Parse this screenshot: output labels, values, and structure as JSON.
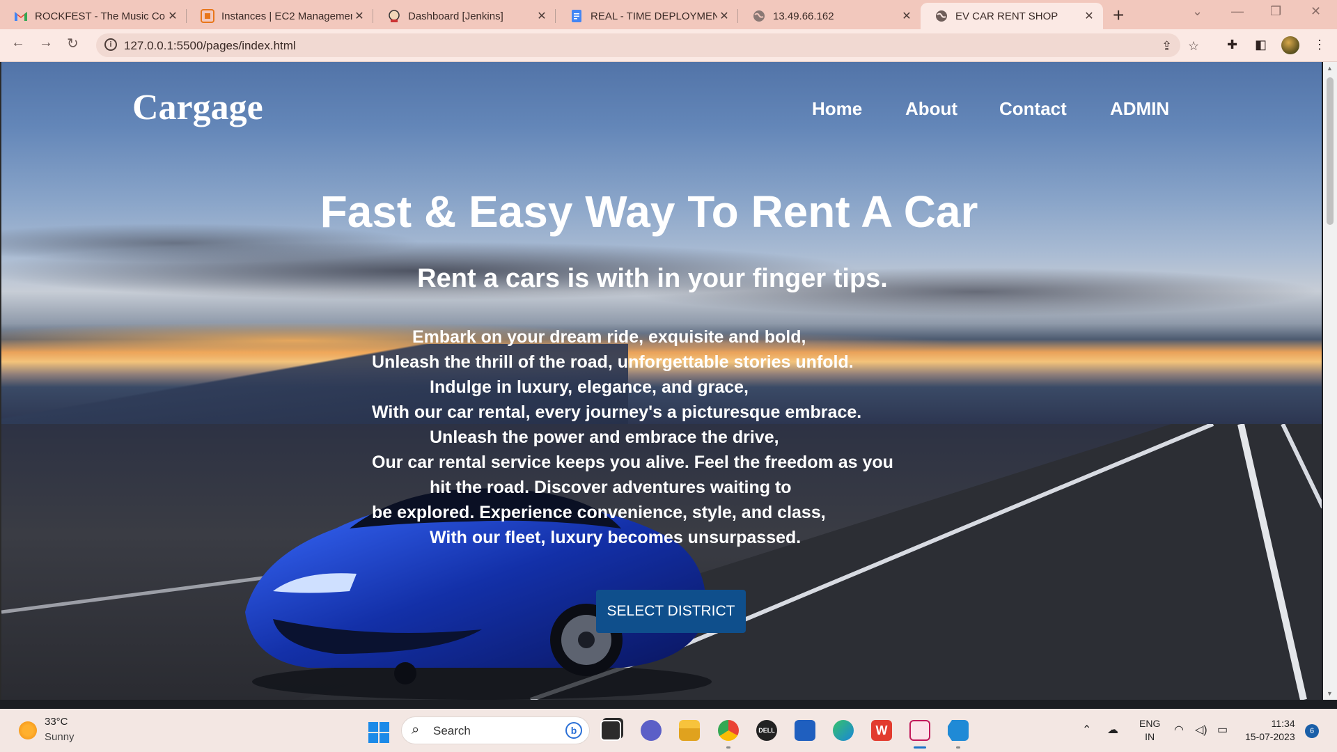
{
  "browser": {
    "tabs": [
      {
        "title": "ROCKFEST - The Music Con",
        "favicon": "gmail-icon"
      },
      {
        "title": "Instances | EC2 Managemen",
        "favicon": "aws-icon"
      },
      {
        "title": "Dashboard [Jenkins]",
        "favicon": "jenkins-icon"
      },
      {
        "title": "REAL - TIME DEPLOYMENT",
        "favicon": "docs-icon"
      },
      {
        "title": "13.49.66.162",
        "favicon": "globe-icon"
      },
      {
        "title": "EV CAR RENT SHOP",
        "favicon": "globe-icon"
      }
    ],
    "active_tab": 5,
    "url": "127.0.0.1:5500/pages/index.html"
  },
  "site": {
    "brand": "Cargage",
    "nav": [
      {
        "label": "Home"
      },
      {
        "label": "About"
      },
      {
        "label": "Contact"
      },
      {
        "label": "ADMIN"
      }
    ],
    "hero_title": "Fast & Easy Way To Rent A Car",
    "hero_subtitle": "Rent a cars is with in your finger tips.",
    "poem_lines": [
      "Embark on your dream ride, exquisite and bold,",
      "Unleash the thrill of the road, unforgettable stories unfold.",
      "Indulge in luxury, elegance, and grace,",
      "With our car rental, every journey's a picturesque embrace.",
      "Unleash the power and embrace the drive,",
      "Our car rental service keeps you alive. Feel the freedom as you",
      "hit the road. Discover adventures waiting to",
      "be explored. Experience convenience, style, and class,",
      "With our fleet, luxury becomes unsurpassed."
    ],
    "cta_label": "SELECT DISTRICT",
    "accent_color": "#0f4f8c"
  },
  "taskbar": {
    "weather_temp": "33°C",
    "weather_desc": "Sunny",
    "search_label": "Search",
    "lang_top": "ENG",
    "lang_bottom": "IN",
    "time": "11:34",
    "date": "15-07-2023",
    "notifications": "6",
    "bing_label": "b",
    "apps": [
      "task-view-icon",
      "chat-icon",
      "file-explorer-icon",
      "chrome-icon",
      "dell-icon",
      "store-icon",
      "edge-icon",
      "wps-office-icon",
      "snipping-tool-icon",
      "vscode-icon"
    ],
    "dell_label": "DELL",
    "wps_label": "W"
  }
}
